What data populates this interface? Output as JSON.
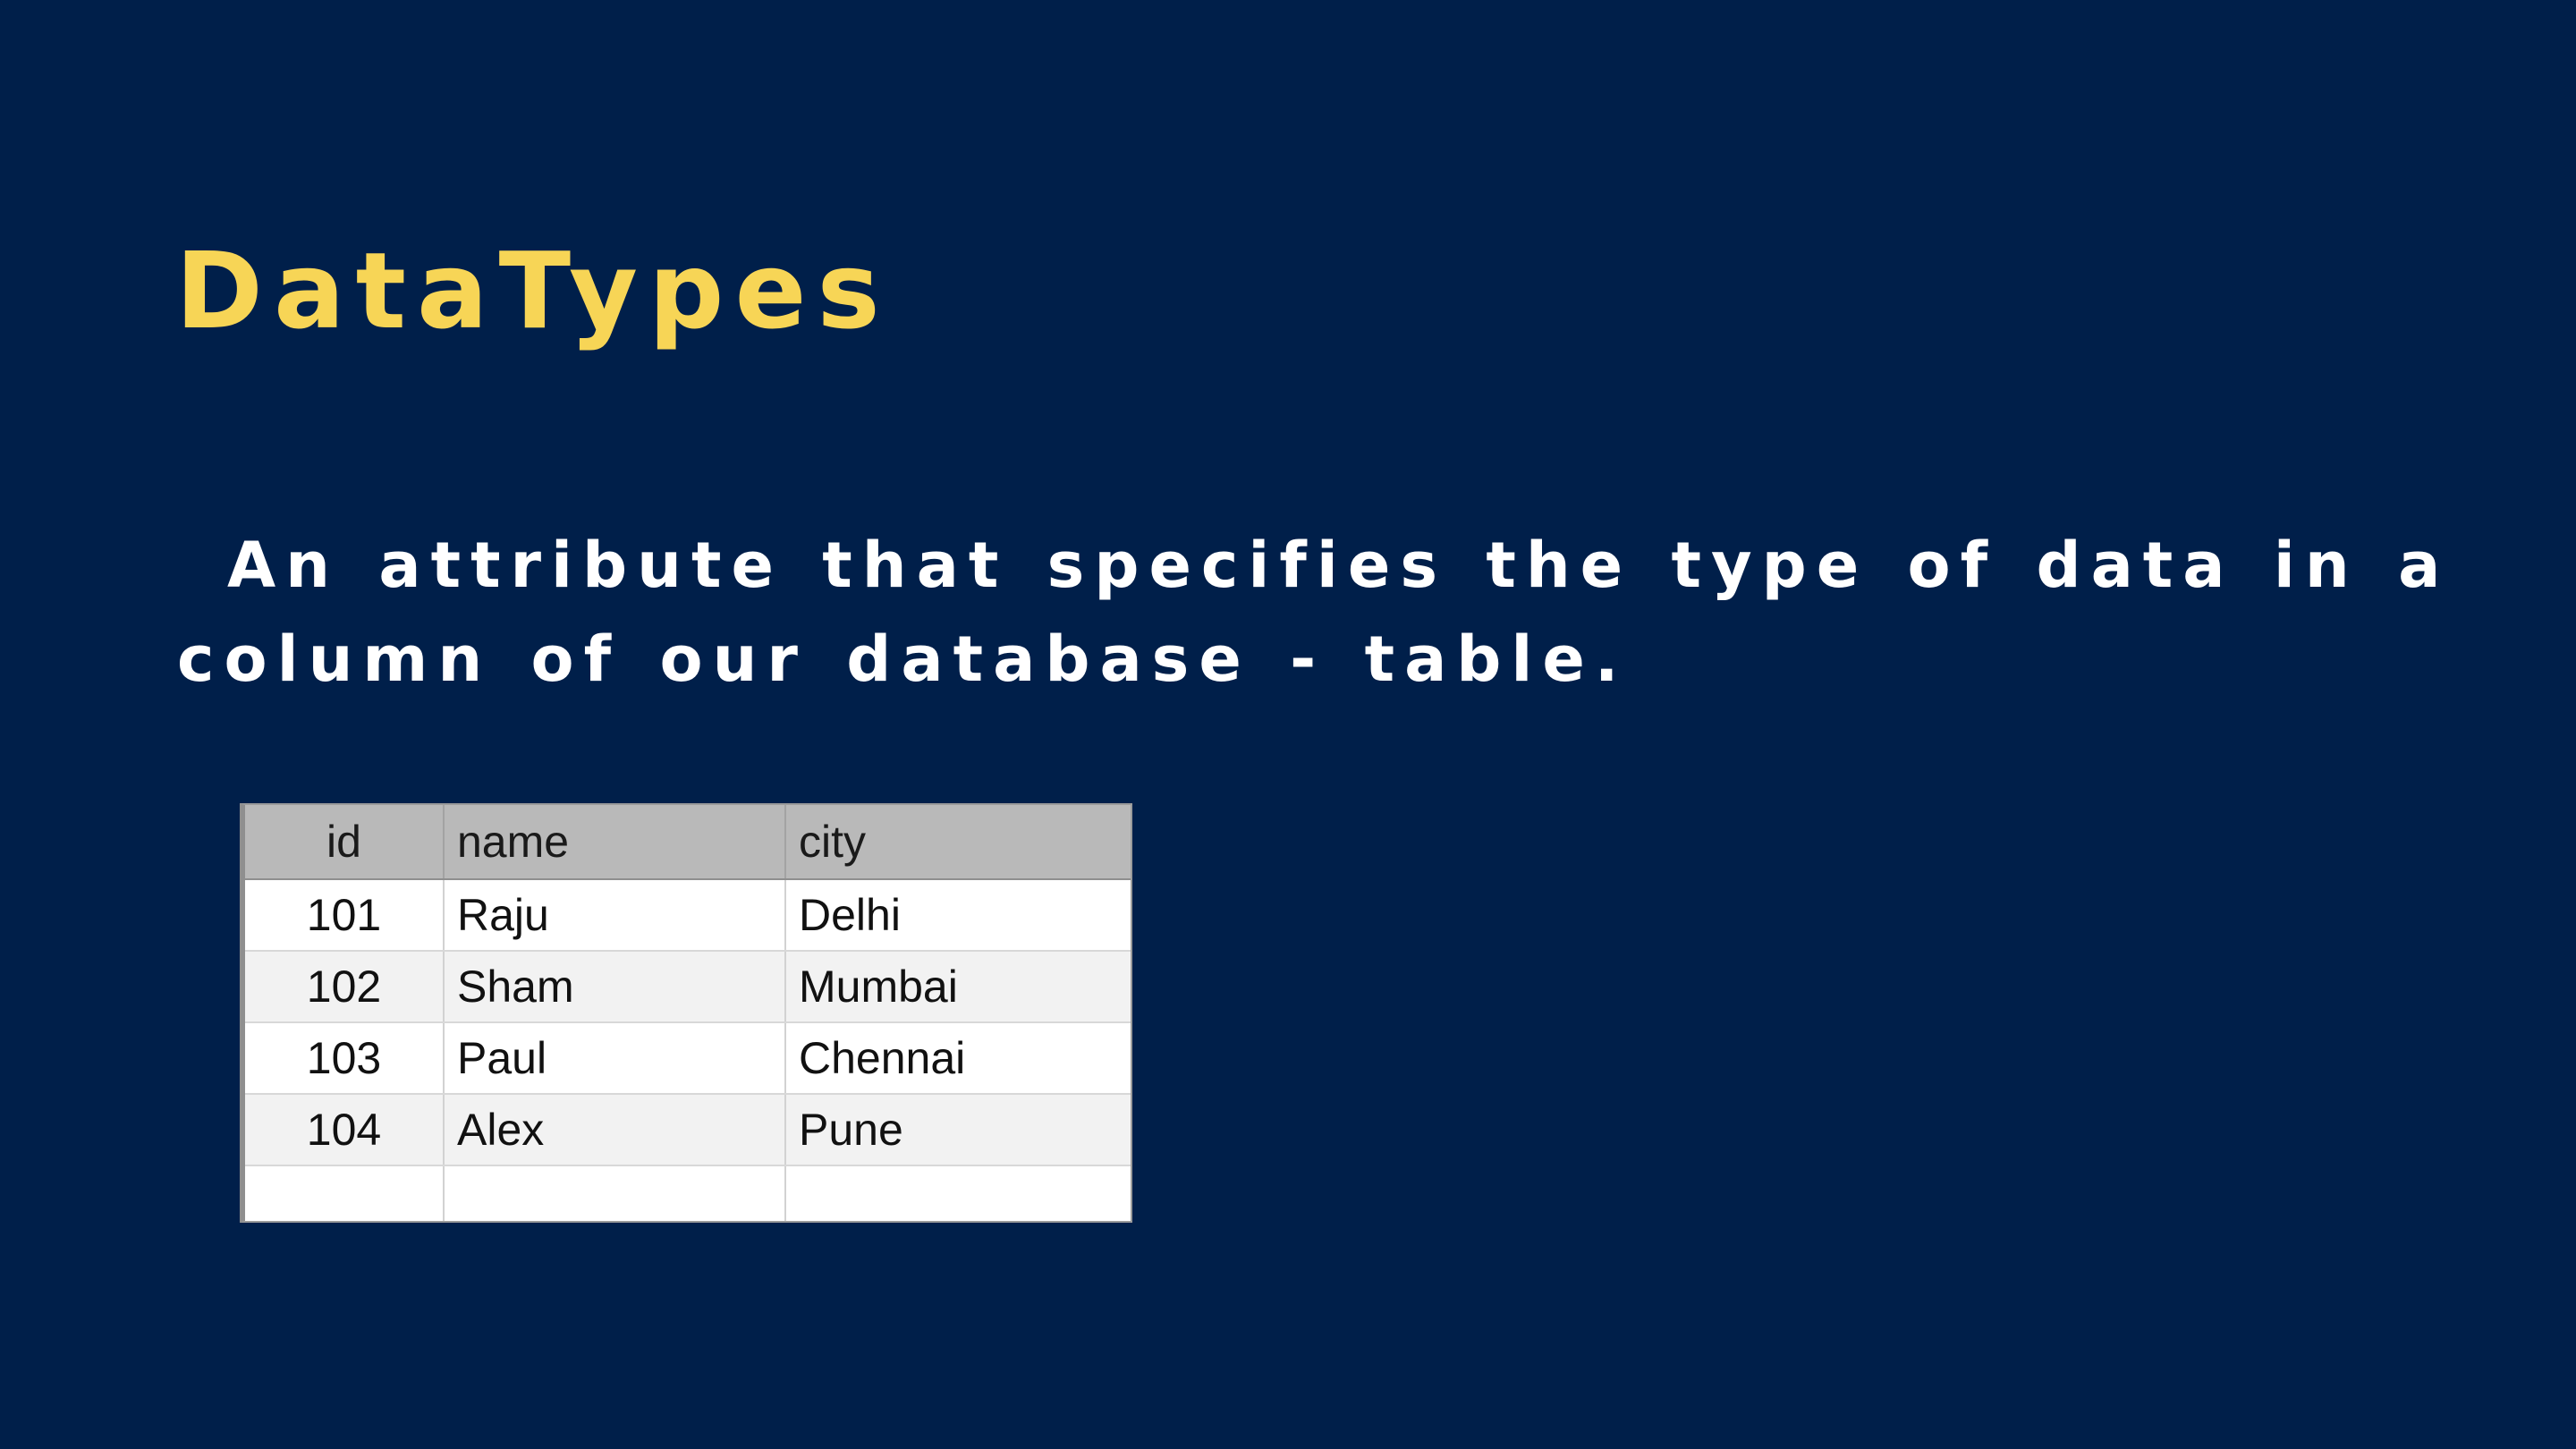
{
  "slide": {
    "title": "DataTypes",
    "description_lines": [
      "An attribute that specifies the type of data in a",
      "column of our database - table."
    ],
    "colors": {
      "background": "#001f4a",
      "title": "#f7d556",
      "body_text": "#ffffff"
    }
  },
  "table": {
    "headers": {
      "id": "id",
      "name": "name",
      "city": "city"
    },
    "rows": [
      {
        "id": "101",
        "name": "Raju",
        "city": "Delhi"
      },
      {
        "id": "102",
        "name": "Sham",
        "city": "Mumbai"
      },
      {
        "id": "103",
        "name": "Paul",
        "city": "Chennai"
      },
      {
        "id": "104",
        "name": "Alex",
        "city": "Pune"
      }
    ]
  }
}
